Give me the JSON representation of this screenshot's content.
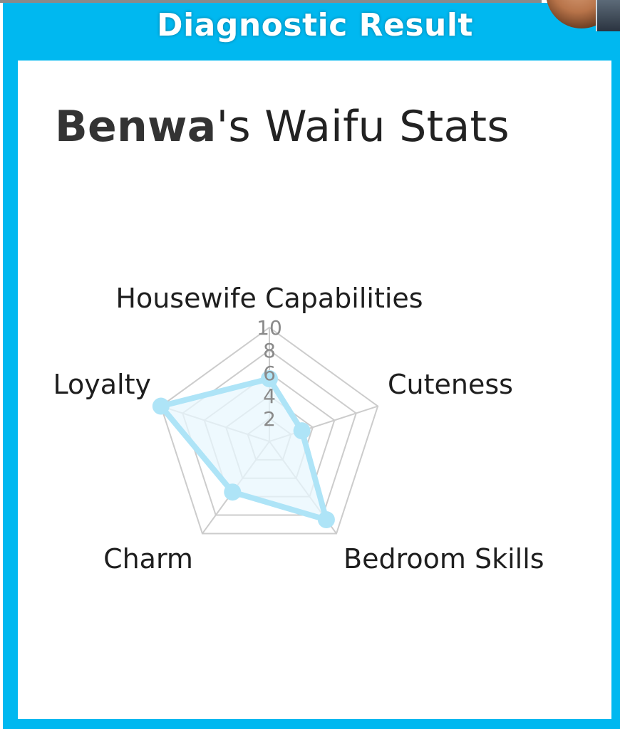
{
  "header": {
    "title": "Diagnostic Result"
  },
  "card": {
    "title_name": "Benwa",
    "title_rest": "'s Waifu Stats"
  },
  "colors": {
    "frame": "#00b8f0",
    "series_fill": "#e8f7fd",
    "series_line": "#aee4f7",
    "grid": "#cccccc"
  },
  "chart_data": {
    "type": "radar",
    "axes": [
      "Housewife Capabilities",
      "Cuteness",
      "Bedroom Skills",
      "Charm",
      "Loyalty"
    ],
    "r_range": [
      0,
      10
    ],
    "r_ticks": [
      "2",
      "4",
      "6",
      "8",
      "10"
    ],
    "series": [
      {
        "values": [
          5.5,
          3,
          8.5,
          5.5,
          10
        ]
      }
    ],
    "legend": "none",
    "grid": true
  }
}
